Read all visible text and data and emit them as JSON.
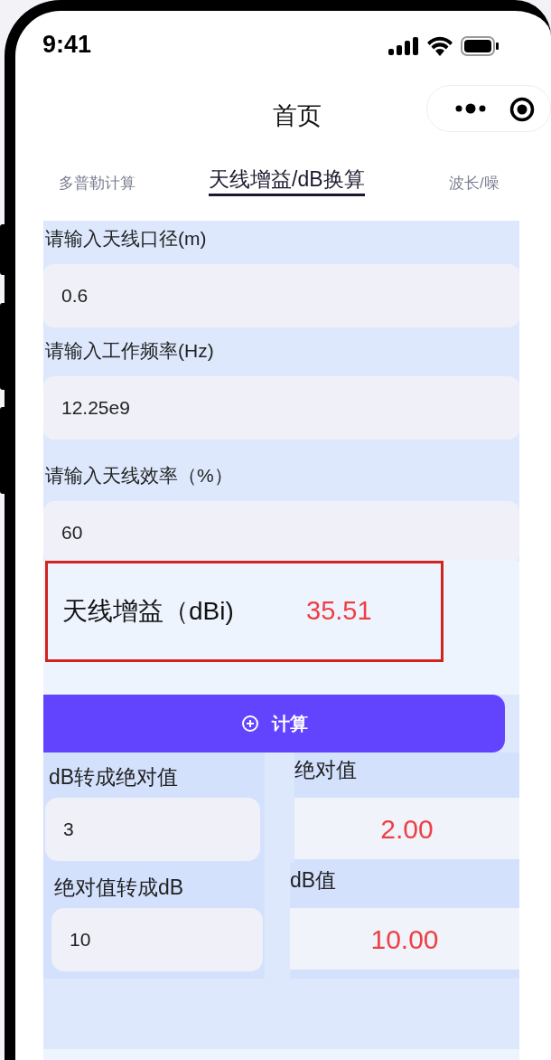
{
  "status_bar": {
    "time": "9:41"
  },
  "nav": {
    "title": "首页"
  },
  "tabs": [
    {
      "label": "多普勒计算",
      "selected": false
    },
    {
      "label": "天线增益/dB换算",
      "selected": true
    },
    {
      "label": "波长/噪",
      "selected": false
    }
  ],
  "antenna_gain": {
    "fields": [
      {
        "label": "请输入天线口径(m)",
        "value": "0.6"
      },
      {
        "label": "请输入工作频率(Hz)",
        "value": "12.25e9"
      },
      {
        "label": "请输入天线效率（%）",
        "value": "60"
      }
    ],
    "result": {
      "label": "天线增益（dBi)",
      "value": "35.51"
    },
    "button": "计算"
  },
  "converters": [
    {
      "title": "dB转成绝对值",
      "input": "3",
      "result_label": "绝对值",
      "result": "2.00"
    },
    {
      "title": "绝对值转成dB",
      "input": "10",
      "result_label": "dB值",
      "result": "10.00"
    }
  ]
}
